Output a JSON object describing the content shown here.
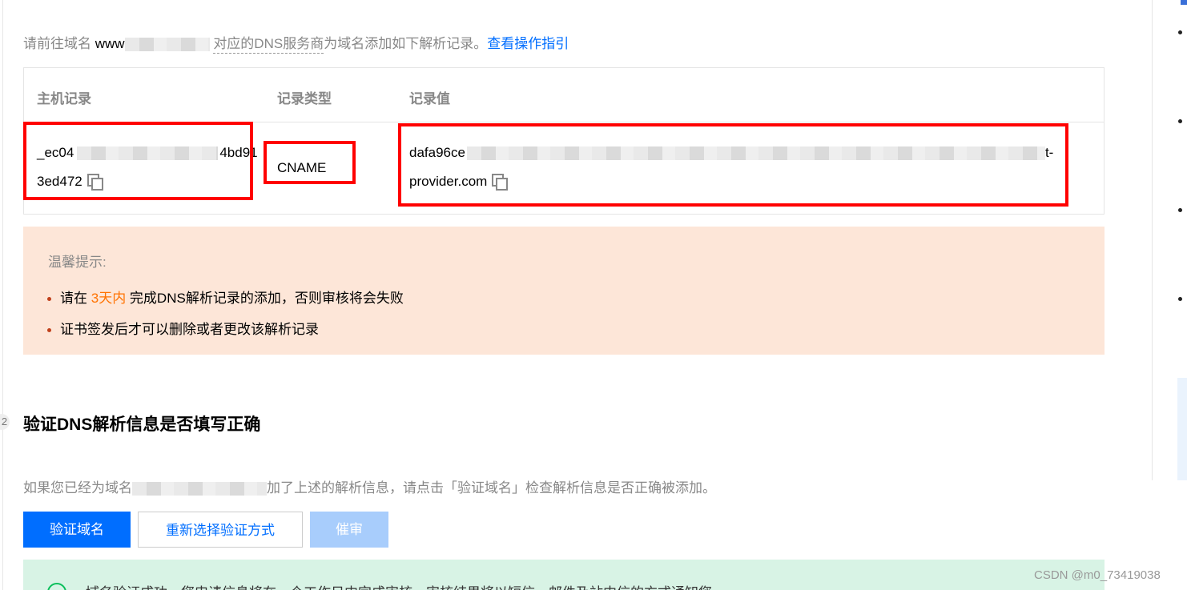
{
  "intro": {
    "prefix": "请前往域名 ",
    "domain_start": "www",
    "dashed_text": "对应的DNS服务商",
    "after": "为域名添加如下解析记录。",
    "guide_link": "查看操作指引"
  },
  "record_table": {
    "headers": [
      "主机记录",
      "记录类型",
      "记录值"
    ],
    "host_record": {
      "line1_start": "_ec04",
      "line1_end": "4bd91",
      "line2": "3ed472"
    },
    "record_type": "CNAME",
    "record_value": {
      "line1_start": "dafa96ce",
      "line1_end": "t-",
      "line2": "provider.com"
    }
  },
  "tip": {
    "title": "温馨提示:",
    "item1_before": "请在 ",
    "item1_highlight": "3天内",
    "item1_after": " 完成DNS解析记录的添加，否则审核将会失败",
    "item2": "证书签发后才可以删除或者更改该解析记录"
  },
  "step2": {
    "number": "2",
    "title": "验证DNS解析信息是否填写正确",
    "desc_before": "如果您已经为域名",
    "desc_after": "加了上述的解析信息，请点击「验证域名」检查解析信息是否正确被添加。"
  },
  "buttons": {
    "verify": "验证域名",
    "reselect": "重新选择验证方式",
    "urge": "催审"
  },
  "success": {
    "text": "域名验证成功，您申请信息将在一个工作日内完成审核，审核结果将以短信、邮件及站内信的方式通知您"
  },
  "watermark": "CSDN @m0_73419038",
  "colors": {
    "primary": "#006eff",
    "highlight": "#ff7200",
    "tip_bg": "#fde6d8",
    "success_bg": "#d8f3e5",
    "annotation": "#ff0000"
  }
}
